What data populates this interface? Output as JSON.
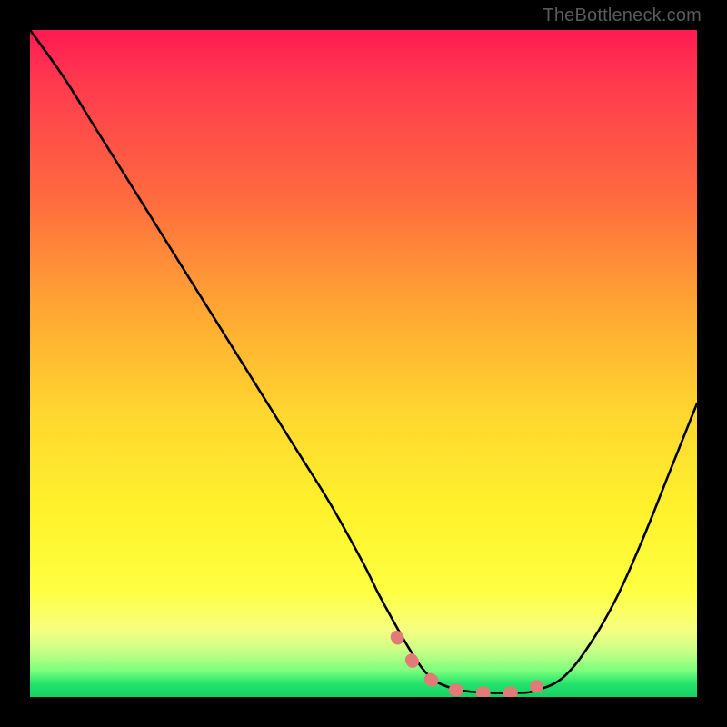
{
  "attribution": "TheBottleneck.com",
  "chart_data": {
    "type": "line",
    "title": "",
    "xlabel": "",
    "ylabel": "",
    "xlim": [
      0,
      100
    ],
    "ylim": [
      0,
      100
    ],
    "series": [
      {
        "name": "bottleneck-curve",
        "x": [
          0,
          5,
          10,
          15,
          20,
          25,
          30,
          35,
          40,
          45,
          50,
          52.5,
          57,
          60,
          63,
          66,
          70,
          73,
          76,
          80,
          84,
          88,
          92,
          96,
          100
        ],
        "values": [
          100,
          93,
          85,
          77,
          69,
          61,
          53,
          45,
          37,
          29,
          20,
          15,
          7,
          3,
          1.4,
          0.8,
          0.6,
          0.6,
          1.0,
          3.0,
          8,
          15,
          24,
          34,
          44
        ]
      }
    ],
    "green_highlight": {
      "comment": "salmon-pink dotted segment along the bottom of the valley",
      "x": [
        55,
        58,
        61,
        63,
        66,
        69,
        72,
        74,
        76
      ],
      "values": [
        9,
        4.5,
        2,
        1.2,
        0.8,
        0.6,
        0.6,
        1.0,
        1.6
      ]
    },
    "background": {
      "type": "vertical-gradient",
      "stops": [
        {
          "pct": 0,
          "color": "#ff1a52"
        },
        {
          "pct": 25,
          "color": "#ff6a3f"
        },
        {
          "pct": 58,
          "color": "#ffd82f"
        },
        {
          "pct": 84,
          "color": "#ffff40"
        },
        {
          "pct": 96,
          "color": "#7dff7d"
        },
        {
          "pct": 100,
          "color": "#18cf63"
        }
      ]
    }
  }
}
